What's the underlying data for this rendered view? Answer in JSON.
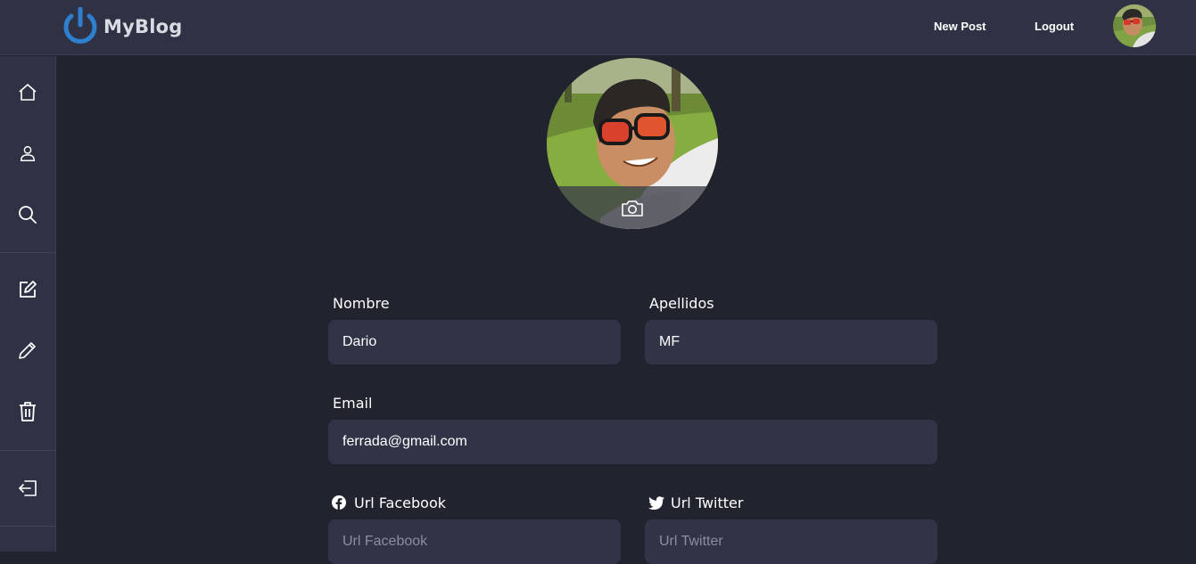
{
  "brand": {
    "name": "MyBlog",
    "color": "#2f7fcf"
  },
  "header": {
    "new_post": "New Post",
    "logout": "Logout"
  },
  "sidebar": {
    "items": [
      {
        "name": "home",
        "icon": "home-icon"
      },
      {
        "name": "profile",
        "icon": "user-icon"
      },
      {
        "name": "search",
        "icon": "search-icon"
      },
      {
        "name": "new-post",
        "icon": "edit-square-icon"
      },
      {
        "name": "edit-post",
        "icon": "pencil-icon"
      },
      {
        "name": "delete-post",
        "icon": "trash-icon"
      },
      {
        "name": "logout",
        "icon": "logout-icon"
      }
    ]
  },
  "profile": {
    "photo_icon": "camera-icon"
  },
  "form": {
    "nombre": {
      "label": "Nombre",
      "value": "Dario"
    },
    "apellidos": {
      "label": "Apellidos",
      "value": "MF"
    },
    "email": {
      "label": "Email",
      "value": "ferrada@gmail.com"
    },
    "facebook": {
      "label": "Url Facebook",
      "value": "",
      "placeholder": "Url Facebook"
    },
    "twitter": {
      "label": "Url Twitter",
      "value": "",
      "placeholder": "Url Twitter"
    }
  },
  "colors": {
    "background": "#21232f",
    "panel": "#2f3244",
    "input": "#313447",
    "text": "#ffffff"
  }
}
